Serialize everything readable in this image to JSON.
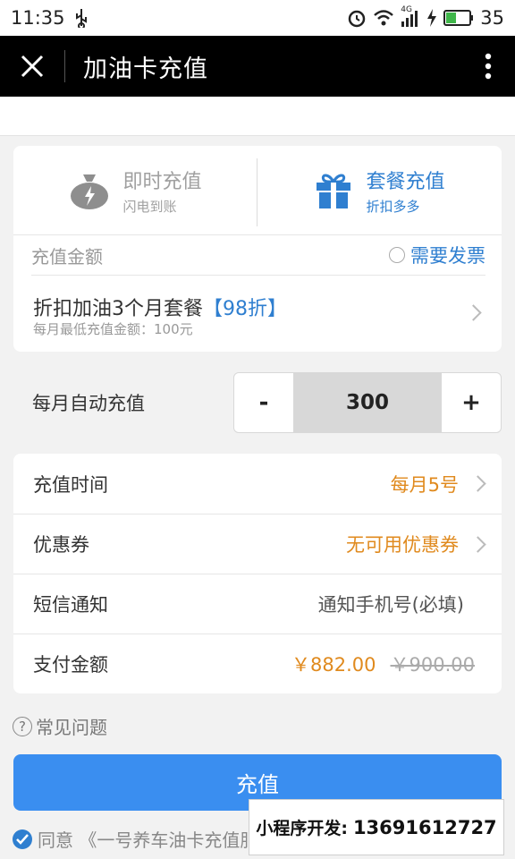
{
  "status_bar": {
    "time": "11:35",
    "network": "4G",
    "battery": "35"
  },
  "title_bar": {
    "title": "加油卡充值",
    "close_icon": "close-icon",
    "more_icon": "more-vertical-icon"
  },
  "modes": [
    {
      "title": "即时充值",
      "subtitle": "闪电到账",
      "icon": "money-bag-icon",
      "active": false
    },
    {
      "title": "套餐充值",
      "subtitle": "折扣多多",
      "icon": "gift-icon",
      "active": true
    }
  ],
  "amount": {
    "label": "充值金额",
    "invoice_label": "需要发票",
    "invoice_checked": false
  },
  "plan": {
    "title": "折扣加油3个月套餐",
    "badge": "【98折】",
    "subtitle": "每月最低充值金额：100元"
  },
  "auto": {
    "label": "每月自动充值",
    "minus": "-",
    "value": "300",
    "plus": "+"
  },
  "form": {
    "recharge_time": {
      "label": "充值时间",
      "value": "每月5号"
    },
    "coupon": {
      "label": "优惠券",
      "value": "无可用优惠券"
    },
    "sms": {
      "label": "短信通知",
      "placeholder": "通知手机号(必填)"
    },
    "payment": {
      "label": "支付金额",
      "price": "￥882.00",
      "original_price": "￥900.00"
    }
  },
  "faq": {
    "icon_glyph": "?",
    "label": "常见问题"
  },
  "submit": {
    "label": "充值"
  },
  "agree": {
    "label": "同意 《一号养车油卡充值服"
  },
  "dev_overlay": {
    "label": "小程序开发:",
    "phone": "13691612727"
  },
  "colors": {
    "accent_blue": "#2f7fd0",
    "button_blue": "#3a8ef0",
    "orange": "#e08a1e",
    "title_bar": "#000000"
  }
}
